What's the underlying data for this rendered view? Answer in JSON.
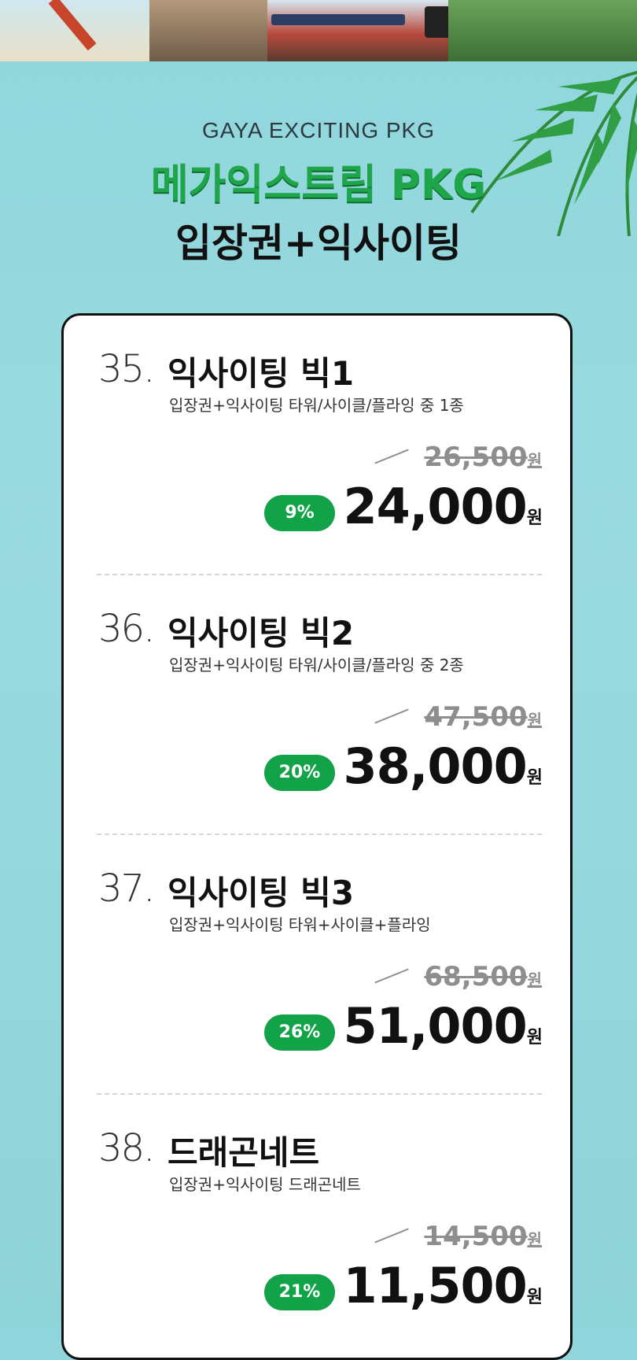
{
  "hero": {
    "subtitle": "GAYA EXCITING PKG",
    "title": "메가익스트림 PKG",
    "title2": "입장권+익사이팅"
  },
  "currency": "원",
  "items": [
    {
      "num": "35.",
      "name": "익사이팅 빅1",
      "desc": "입장권+익사이팅 타워/사이클/플라잉 중 1종",
      "original": "26,500",
      "discount": "9%",
      "price": "24,000"
    },
    {
      "num": "36.",
      "name": "익사이팅 빅2",
      "desc": "입장권+익사이팅 타워/사이클/플라잉 중 2종",
      "original": "47,500",
      "discount": "20%",
      "price": "38,000"
    },
    {
      "num": "37.",
      "name": "익사이팅 빅3",
      "desc": "입장권+익사이팅 타워+사이클+플라잉",
      "original": "68,500",
      "discount": "26%",
      "price": "51,000"
    },
    {
      "num": "38.",
      "name": "드래곤네트",
      "desc": "입장권+익사이팅 드래곤네트",
      "original": "14,500",
      "discount": "21%",
      "price": "11,500"
    }
  ],
  "colors": {
    "accent_green": "#12a247",
    "background": "#8fd6dc"
  }
}
